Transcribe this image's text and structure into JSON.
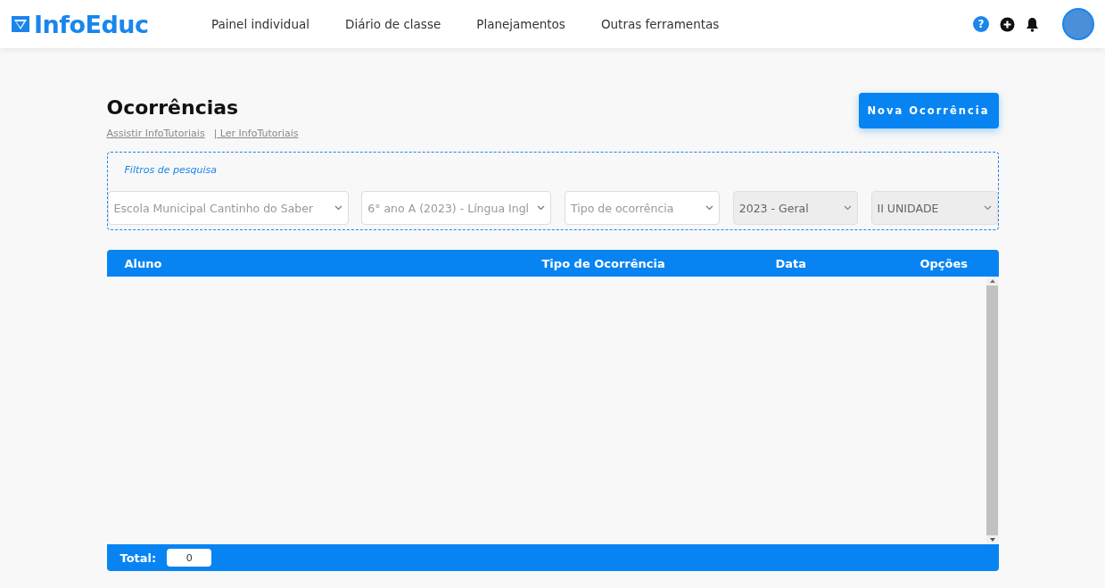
{
  "header": {
    "logo": "InfoEduc",
    "nav": [
      "Painel individual",
      "Diário de classe",
      "Planejamentos",
      "Outras ferramentas"
    ],
    "help_label": "?"
  },
  "page": {
    "title": "Ocorrências",
    "links": [
      "Assistir InfoTutoriais",
      "| Ler InfoTutoriais"
    ],
    "new_button": "Nova Ocorrência"
  },
  "filters": {
    "legend": "Filtros de pesquisa",
    "selects": [
      {
        "value": "Escola Municipal Cantinho do Saber",
        "disabled": false
      },
      {
        "value": "6° ano A (2023) - Língua Ingl",
        "disabled": false
      },
      {
        "placeholder": "Tipo de ocorrência",
        "disabled": false
      },
      {
        "value": "2023 - Geral",
        "disabled": true
      },
      {
        "value": "II UNIDADE",
        "disabled": true
      }
    ]
  },
  "table": {
    "columns": [
      "Aluno",
      "Tipo de Ocorrência",
      "Data",
      "Opções"
    ]
  },
  "footer": {
    "total_label": "Total:",
    "total_value": "0"
  }
}
